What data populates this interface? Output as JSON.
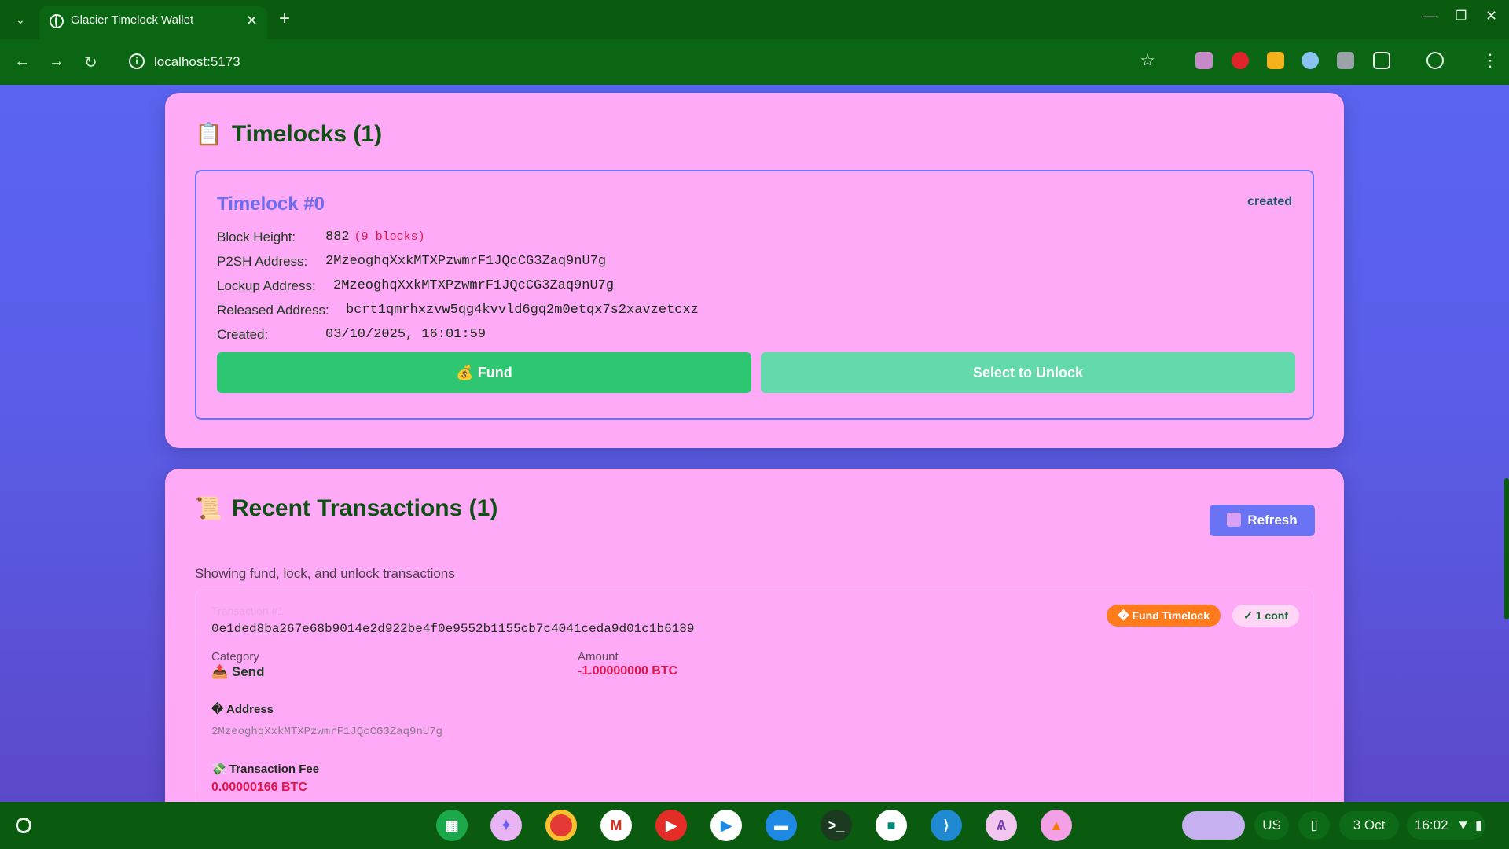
{
  "browser": {
    "tab_title": "Glacier Timelock Wallet",
    "url": "localhost:5173"
  },
  "timelocks": {
    "heading": "Timelocks (1)",
    "heading_emoji": "📋",
    "item": {
      "name": "Timelock #0",
      "status": "created",
      "block_height_label": "Block Height:",
      "block_height_value": "882",
      "block_height_sub": "(9 blocks)",
      "p2sh_label": "P2SH Address:",
      "p2sh_value": "2MzeoghqXxkMTXPzwmrF1JQcCG3Zaq9nU7g",
      "lockup_label": "Lockup Address:",
      "lockup_value": "2MzeoghqXxkMTXPzwmrF1JQcCG3Zaq9nU7g",
      "released_label": "Released Address:",
      "released_value": "bcrt1qmrhxzvw5qg4kvvld6gq2m0etqx7s2xavzetcxz",
      "created_label": "Created:",
      "created_value": "03/10/2025, 16:01:59",
      "fund_button": "💰 Fund",
      "unlock_button": "Select to Unlock"
    }
  },
  "transactions": {
    "heading": "Recent Transactions (1)",
    "heading_emoji": "📜",
    "refresh_button": "Refresh",
    "subtitle": "Showing fund, lock, and unlock transactions",
    "item": {
      "label": "Transaction #1",
      "hash": "0e1ded8ba267e68b9014e2d922be4f0e9552b1155cb7c4041ceda9d01c1b6189",
      "type_badge": "� Fund Timelock",
      "conf_badge": "✓ 1 conf",
      "category_label": "Category",
      "category_value": "📤 Send",
      "amount_label": "Amount",
      "amount_value": "-1.00000000 BTC",
      "address_label": "� Address",
      "address_value": "2MzeoghqXxkMTXPzwmrF1JQcCG3Zaq9nU7g",
      "fee_label": "💸 Transaction Fee",
      "fee_value": "0.00000166 BTC"
    }
  },
  "taskbar": {
    "keyboard": "US",
    "date": "3 Oct",
    "time": "16:02"
  }
}
